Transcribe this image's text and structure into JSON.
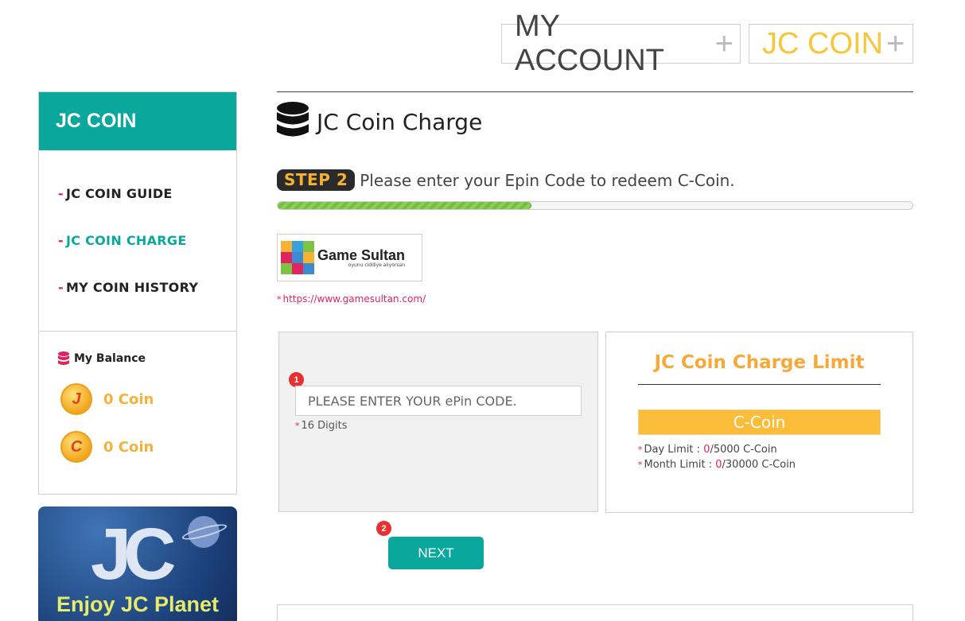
{
  "header": {
    "my_account": "MY ACCOUNT",
    "jc_coin": "JC COIN",
    "plus_glyph": "+"
  },
  "sidebar": {
    "title": "JC COIN",
    "items": [
      {
        "label": "JC COIN GUIDE",
        "active": false
      },
      {
        "label": "JC COIN CHARGE",
        "active": true
      },
      {
        "label": "MY COIN HISTORY",
        "active": false
      }
    ],
    "dash": "-"
  },
  "balance": {
    "title": "My Balance",
    "coins": [
      {
        "icon": "j-coin-icon",
        "letter": "J",
        "value": "0 Coin"
      },
      {
        "icon": "c-coin-icon",
        "letter": "C",
        "value": "0 Coin"
      }
    ]
  },
  "banner": {
    "logo": "JC",
    "text": "Enjoy JC Planet"
  },
  "main": {
    "title": "JC Coin Charge",
    "step_badge": "STEP 2",
    "step_text": "Please enter your Epin Code to redeem C-Coin.",
    "progress": 0.4,
    "vendor": {
      "name": "Game Sultan",
      "tagline": "oyunu ciddiye alıyorsan",
      "url": "https://www.gamesultan.com/"
    },
    "epin": {
      "step_num": "1",
      "placeholder": "PLEASE ENTER YOUR ePin CODE.",
      "value": "",
      "hint": "16 Digits"
    },
    "limit": {
      "title": "JC Coin Charge Limit",
      "currency": "C-Coin",
      "day_label": "Day Limit : ",
      "day_used": "0",
      "day_max": "/5000 C-Coin",
      "month_label": "Month Limit : ",
      "month_used": "0",
      "month_max": "/30000 C-Coin"
    },
    "next": {
      "step_num": "2",
      "label": "NEXT"
    }
  },
  "colors": {
    "teal": "#0aa89c",
    "gold": "#f7c63b",
    "accent_red": "#e0245e",
    "coin_orange": "#f5b23a"
  }
}
